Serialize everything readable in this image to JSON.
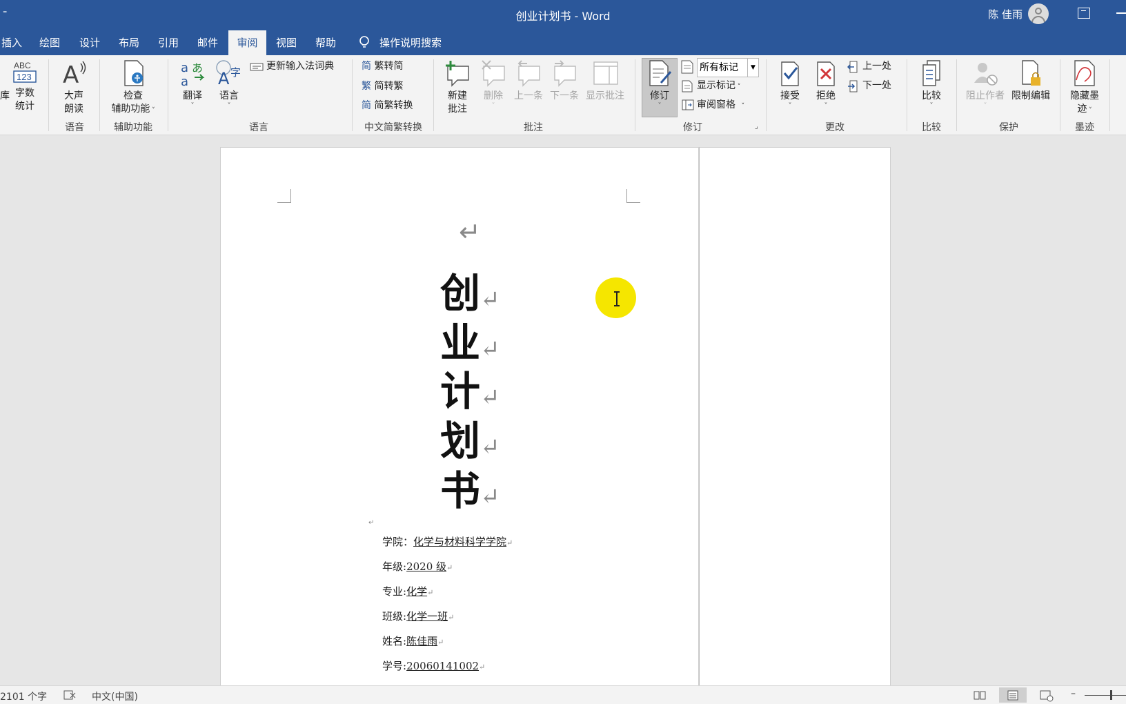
{
  "window": {
    "title": "创业计划书  -  Word",
    "user_name": "陈 佳雨",
    "qat_glyph": "⁼"
  },
  "tabs": [
    "插入",
    "绘图",
    "设计",
    "布局",
    "引用",
    "邮件",
    "审阅",
    "视图",
    "帮助"
  ],
  "active_tab": "审阅",
  "tell_me": "操作说明搜索",
  "ribbon": {
    "proofing": {
      "partial": "库",
      "word_count": "字数\n统计"
    },
    "speech": {
      "read_aloud_1": "大声",
      "read_aloud_2": "朗读",
      "group": "语音"
    },
    "accessibility": {
      "check_1": "检查",
      "check_2": "辅助功能",
      "group": "辅助功能"
    },
    "language": {
      "translate": "翻译",
      "language": "语言",
      "update_ime": "更新输入法词典",
      "group": "语言"
    },
    "chinese_conversion": {
      "to_simplified": "繁转简",
      "to_traditional": "简转繁",
      "convert": "简繁转换",
      "group": "中文简繁转换"
    },
    "comments": {
      "new_1": "新建",
      "new_2": "批注",
      "delete": "删除",
      "previous": "上一条",
      "next": "下一条",
      "show": "显示批注",
      "group": "批注"
    },
    "tracking": {
      "track": "修订",
      "markup_select": "所有标记",
      "show_markup": "显示标记",
      "review_pane": "审阅窗格",
      "group": "修订"
    },
    "changes": {
      "accept": "接受",
      "reject": "拒绝",
      "previous": "上一处",
      "next": "下一处",
      "group": "更改"
    },
    "compare": {
      "compare": "比较",
      "group": "比较"
    },
    "protect": {
      "block_authors": "阻止作者",
      "restrict": "限制编辑",
      "group": "保护"
    },
    "ink": {
      "hide_1": "隐藏墨",
      "hide_2": "迹",
      "group": "墨迹"
    }
  },
  "document": {
    "return_mark": "↵",
    "title_chars": [
      "创",
      "业",
      "计",
      "划",
      "书"
    ],
    "fields": [
      {
        "label": "学院：",
        "value": "化学与材料科学学院"
      },
      {
        "label": "年级:",
        "value": "2020 级"
      },
      {
        "label": "专业:",
        "value": "化学"
      },
      {
        "label": "班级:",
        "value": "化学一班"
      },
      {
        "label": "姓名:",
        "value": "陈佳雨"
      },
      {
        "label": "学号:",
        "value": "20060141002"
      }
    ]
  },
  "status": {
    "word_count": "2101 个字",
    "language": "中文(中国)"
  },
  "colors": {
    "word_blue": "#2b579a",
    "ribbon_bg": "#f3f3f3",
    "cursor_highlight": "#f5e600"
  }
}
